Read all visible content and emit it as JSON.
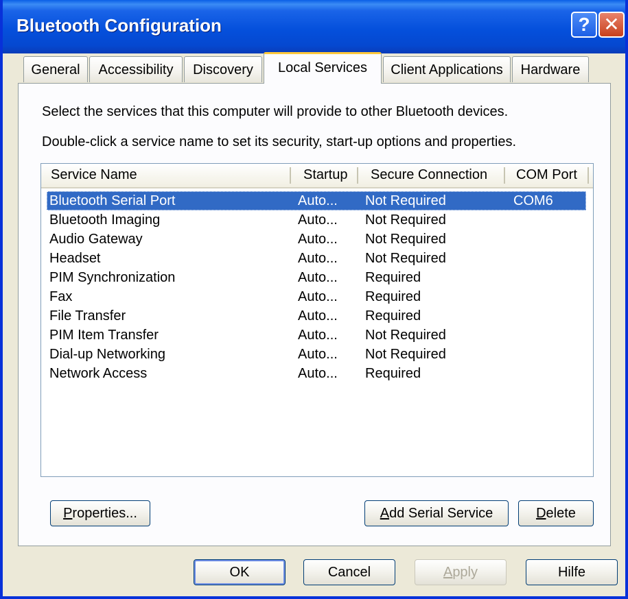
{
  "window": {
    "title": "Bluetooth Configuration",
    "help_glyph": "?",
    "close_glyph": "✕"
  },
  "tabs": [
    {
      "label": "General"
    },
    {
      "label": "Accessibility"
    },
    {
      "label": "Discovery"
    },
    {
      "label": "Local Services"
    },
    {
      "label": "Client Applications"
    },
    {
      "label": "Hardware"
    }
  ],
  "active_tab": "Local Services",
  "panel": {
    "description_1": "Select the services that this computer will provide to other Bluetooth devices.",
    "description_2": "Double-click a service name to set its security, start-up options and properties."
  },
  "services": {
    "columns": [
      "Service Name",
      "Startup",
      "Secure Connection",
      "COM Port"
    ],
    "selected_index": 0,
    "rows": [
      {
        "name": "Bluetooth Serial Port",
        "startup": "Auto...",
        "secure": "Not Required",
        "com": "COM6"
      },
      {
        "name": "Bluetooth Imaging",
        "startup": "Auto...",
        "secure": "Not Required",
        "com": ""
      },
      {
        "name": "Audio Gateway",
        "startup": "Auto...",
        "secure": "Not Required",
        "com": ""
      },
      {
        "name": "Headset",
        "startup": "Auto...",
        "secure": "Not Required",
        "com": ""
      },
      {
        "name": "PIM Synchronization",
        "startup": "Auto...",
        "secure": "Required",
        "com": ""
      },
      {
        "name": "Fax",
        "startup": "Auto...",
        "secure": "Required",
        "com": ""
      },
      {
        "name": "File Transfer",
        "startup": "Auto...",
        "secure": "Required",
        "com": ""
      },
      {
        "name": "PIM Item Transfer",
        "startup": "Auto...",
        "secure": "Not Required",
        "com": ""
      },
      {
        "name": "Dial-up Networking",
        "startup": "Auto...",
        "secure": "Not Required",
        "com": ""
      },
      {
        "name": "Network Access",
        "startup": "Auto...",
        "secure": "Required",
        "com": ""
      }
    ]
  },
  "panel_buttons": {
    "properties_mnemonic": "P",
    "properties_rest": "roperties...",
    "add_serial_mnemonic": "A",
    "add_serial_rest": "dd Serial Service",
    "delete_mnemonic": "D",
    "delete_rest": "elete"
  },
  "dialog_buttons": {
    "ok": "OK",
    "cancel": "Cancel",
    "apply_mnemonic": "A",
    "apply_rest": "pply",
    "help": "Hilfe"
  },
  "colors": {
    "title_bar": "#0550DC",
    "selection": "#316AC5",
    "active_tab_accent": "#FFC83C",
    "close_button": "#C8401C"
  }
}
